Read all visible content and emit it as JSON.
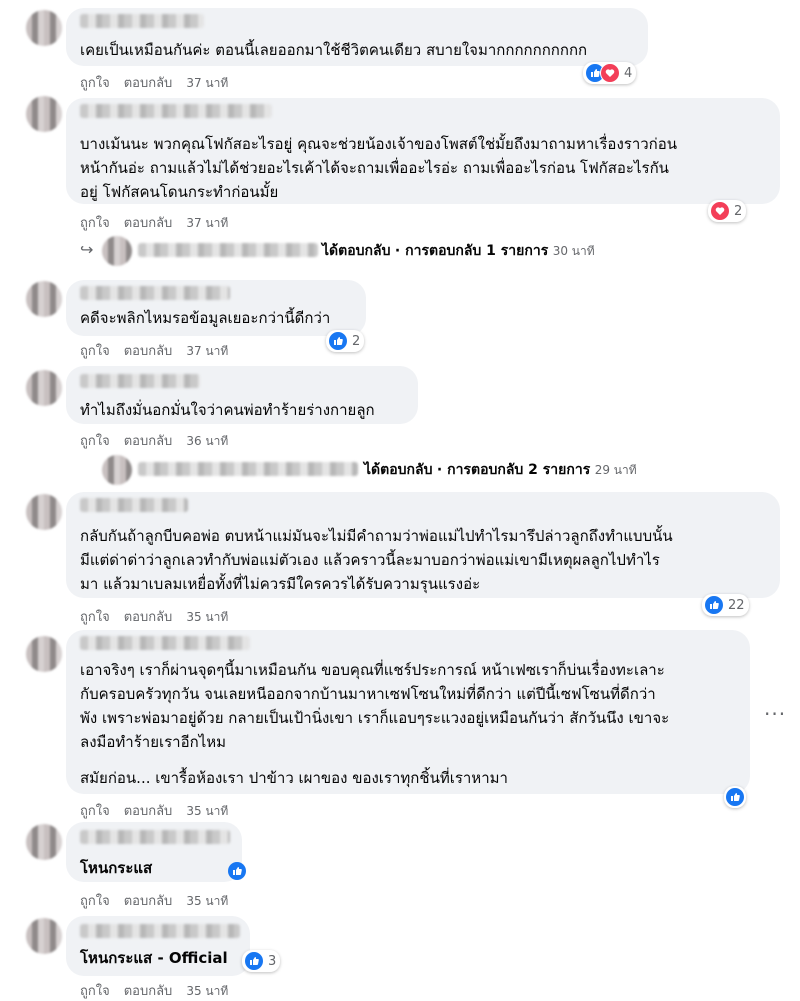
{
  "actions": {
    "like": "ถูกใจ",
    "reply": "ตอบกลับ"
  },
  "comments": [
    {
      "text": "เคยเป็นเหมือนกันค่ะ ตอนนี้เลยออกมาใช้ชีวิตคนเดียว สบายใจมากกกกกกกกกก",
      "time": "37 นาที",
      "reactions": "4"
    },
    {
      "text": "บางเม้นนะ พวกคุณโฟกัสอะไรอยู่ คุณจะช่วยน้องเจ้าของโพสต์ใช่มั้ยถึงมาถามหาเรื่องราวก่อน\nหน้ากันอ่ะ ถามแล้วไม่ได้ช่วยอะไรเค้าได้จะถามเพื่ออะไรอ่ะ ถามเพื่ออะไรก่อน โฟกัสอะไรกัน\nอยู่ โฟกัสคนโดนกระทำก่อนมั้ย",
      "time": "37 นาที",
      "reactions": "2",
      "reply_summary": {
        "verb": "ได้ตอบกลับ",
        "count": "· การตอบกลับ 1 รายการ",
        "time": "30 นาที"
      }
    },
    {
      "text": "คดีจะพลิกไหมรอข้อมูลเยอะกว่านี้ดีกว่า",
      "time": "37 นาที",
      "reactions": "2"
    },
    {
      "text": "ทำไมถึงมั่นอกมั่นใจว่าคนพ่อทำร้ายร่างกายลูก",
      "time": "36 นาที",
      "reply_summary": {
        "verb": "ได้ตอบกลับ",
        "count": "· การตอบกลับ 2 รายการ",
        "time": "29 นาที"
      }
    },
    {
      "text": "กลับกันถ้าลูกบีบคอพ่อ ตบหน้าแม่มันจะไม่มีคำถามว่าพ่อแม่ไปทำไรมารึปล่าวลูกถึงทำแบบนั้น\nมีแต่ด่าด่าว่าลูกเลวทำกับพ่อแม่ตัวเอง แล้วคราวนี้ละมาบอกว่าพ่อแม่เขามีเหตุผลลูกไปทำไร\nมา แล้วมาเบลมเหยื่อทั้งที่ไม่ควรมีใครควรได้รับความรุนแรงอ่ะ",
      "time": "35 นาที",
      "reactions": "22"
    },
    {
      "text": "เอาจริงๆ เราก็ผ่านจุดๆนี้มาเหมือนกัน ขอบคุณที่แชร์ประการณ์ หน้าเฟซเราก็บ่นเรื่องทะเลาะ\nกับครอบครัวทุกวัน จนเลยหนีออกจากบ้านมาหาเซฟโซนใหม่ที่ดีกว่า แต่ปีนี้เซฟโซนที่ดีกว่า\nพัง เพราะพ่อมาอยู่ด้วย กลายเป็นเป้านิ่งเขา เราก็แอบๆระแวงอยู่เหมือนกันว่า สักวันนึง เขาจะ\nลงมือทำร้ายเราอีกไหม",
      "text2": "สมัยก่อน... เขารื้อห้องเรา ปาข้าว เผาของ ของเราทุกชิ้นที่เราหามา",
      "time": "35 นาที"
    },
    {
      "text": "โหนกระแส",
      "time": "35 นาที"
    },
    {
      "text": "โหนกระแส - Official",
      "time": "35 นาที",
      "reactions": "3"
    }
  ],
  "more": "···",
  "colors": {
    "like": "#1877f2",
    "heart": "#f33e58",
    "bubble": "#f0f2f5",
    "meta": "#65676b"
  }
}
